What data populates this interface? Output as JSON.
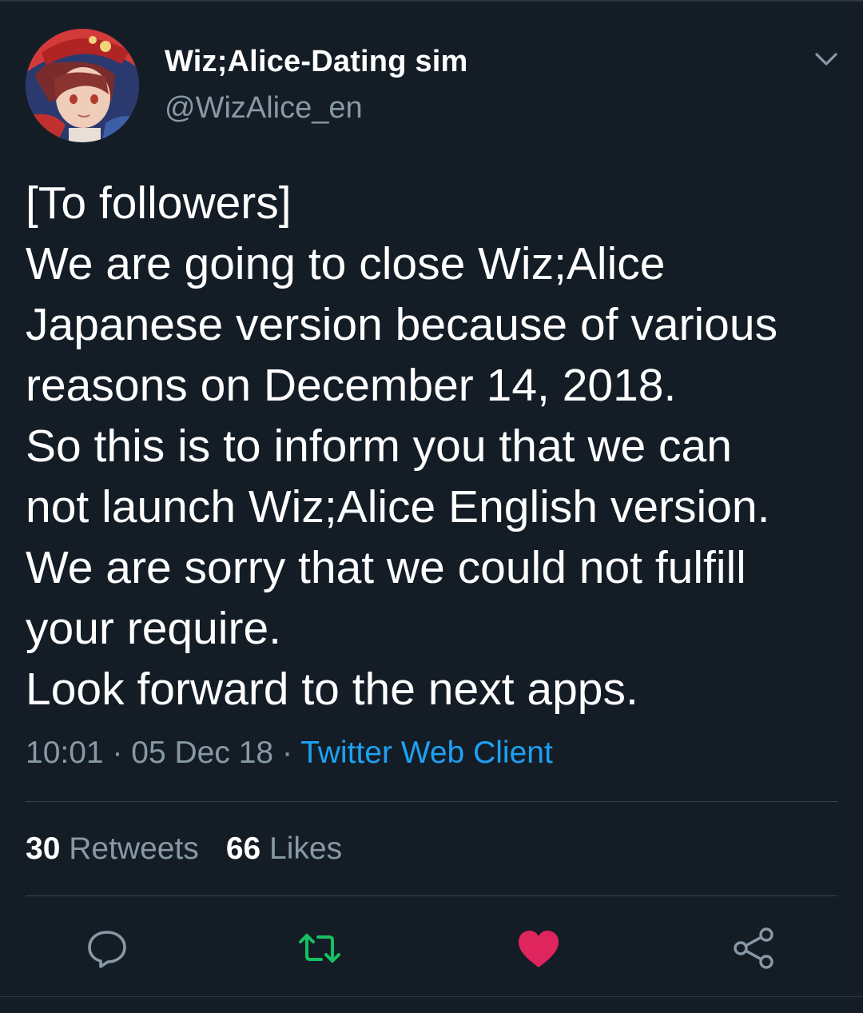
{
  "tweet": {
    "author": {
      "display_name": "Wiz;Alice-Dating sim",
      "handle": "@WizAlice_en"
    },
    "text_lines": [
      "[To followers]",
      "We are going to close Wiz;Alice",
      "Japanese version because of various",
      "reasons on December 14, 2018.",
      "So this is to inform you that we can",
      "not launch Wiz;Alice English version.",
      "We are sorry that we could not fulfill",
      "your require.",
      "Look forward to the next apps."
    ],
    "time": "10:01",
    "separator": "·",
    "date": "05 Dec 18",
    "source": "Twitter Web Client",
    "retweets_count": "30",
    "retweets_label": "Retweets",
    "likes_count": "66",
    "likes_label": "Likes"
  },
  "colors": {
    "background": "#141d26",
    "secondary_text": "#8899a6",
    "link": "#1da1f2",
    "retweet_active": "#17bf63",
    "like_active": "#e0245e"
  },
  "icons": {
    "caret": "chevron-down-icon",
    "reply": "reply-icon",
    "retweet": "retweet-icon",
    "like": "heart-icon",
    "share": "share-icon"
  },
  "state": {
    "retweeted": true,
    "liked": true
  }
}
